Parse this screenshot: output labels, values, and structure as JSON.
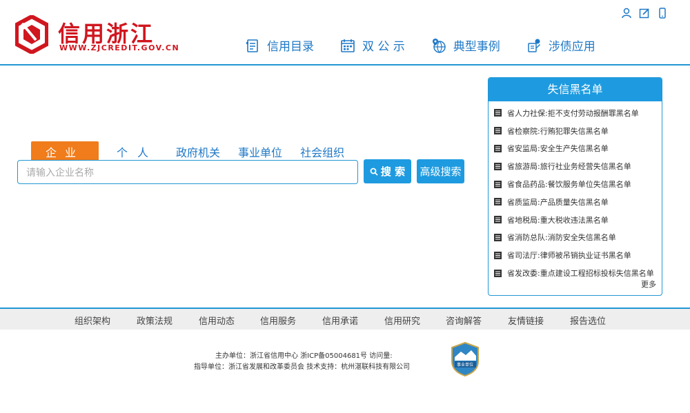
{
  "site": {
    "logo_title": "信用浙江",
    "logo_url": "WWW.ZJCREDIT.GOV.CN"
  },
  "top_icons": [
    "user-icon",
    "edit-icon",
    "mobile-icon"
  ],
  "nav": [
    {
      "label": "信用目录",
      "icon": "catalog-icon"
    },
    {
      "label": "双 公 示",
      "icon": "calendar-icon"
    },
    {
      "label": "典型事例",
      "icon": "globe-pin-icon"
    },
    {
      "label": "涉债应用",
      "icon": "debt-app-icon"
    }
  ],
  "search": {
    "tabs": [
      "企业",
      "个人",
      "政府机关",
      "事业单位",
      "社会组织"
    ],
    "active_tab": "企业",
    "placeholder": "请输入企业名称",
    "search_label": "搜 索",
    "advanced_label": "高级搜索"
  },
  "blacklist": {
    "title": "失信黑名单",
    "items": [
      "省人力社保:拒不支付劳动报酬罪黑名单",
      "省检察院:行贿犯罪失信黑名单",
      "省安监局:安全生产失信黑名单",
      "省旅游局:旅行社业务经营失信黑名单",
      "省食品药品:餐饮服务单位失信黑名单",
      "省质监局:产品质量失信黑名单",
      "省地税局:重大税收违法黑名单",
      "省消防总队:消防安全失信黑名单",
      "省司法厅:律师被吊销执业证书黑名单",
      "省发改委:重点建设工程招标投标失信黑名单"
    ],
    "more_label": "更多"
  },
  "footer": {
    "links": [
      "组织架构",
      "政策法规",
      "信用动态",
      "信用服务",
      "信用承诺",
      "信用研究",
      "咨询解答",
      "友情链接",
      "报告选位"
    ],
    "line1": "主办单位：浙江省信用中心  浙ICP备05004681号  访问量:",
    "line2": "指导单位：浙江省发展和改革委员会  技术支持：杭州湛联科技有限公司",
    "badge_text": "事业单位"
  },
  "colors": {
    "brand_red": "#d0161f",
    "accent_blue": "#1e9be0",
    "active_tab_orange": "#f07c1b"
  }
}
